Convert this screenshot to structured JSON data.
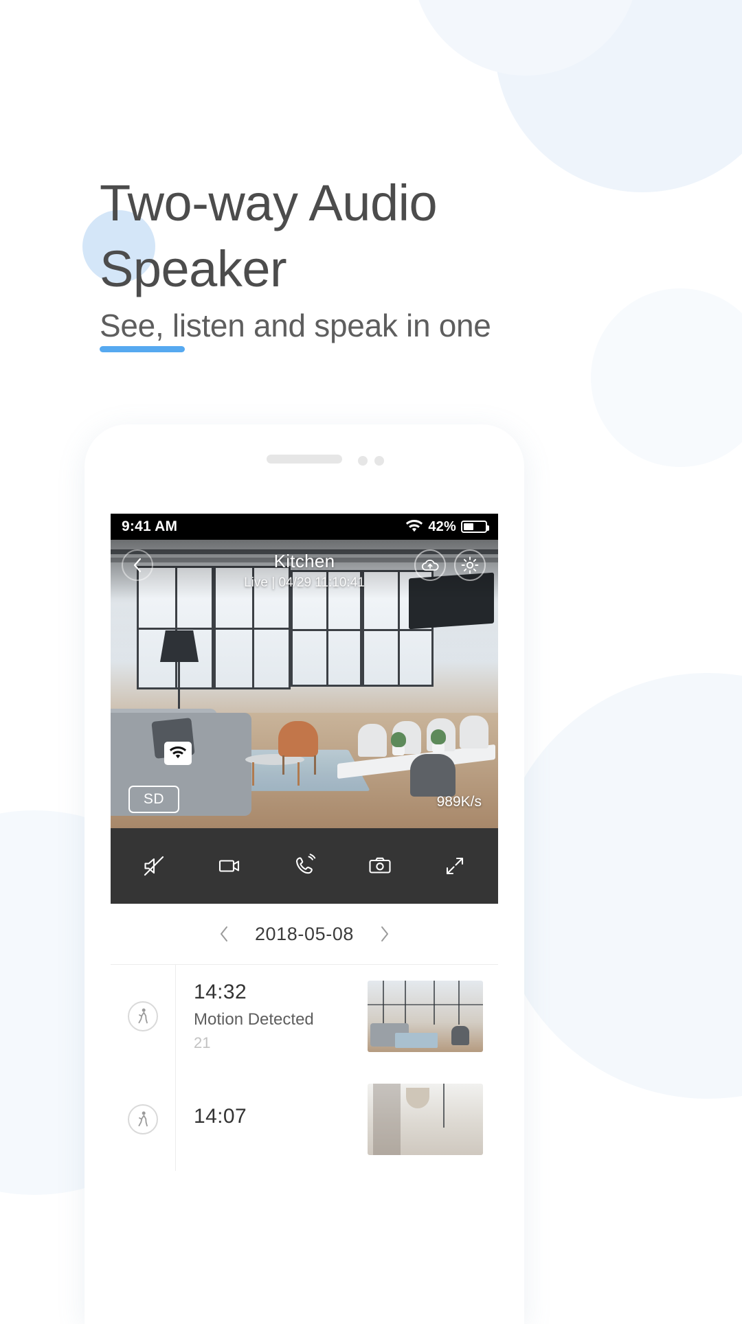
{
  "hero": {
    "headline": "Two-way Audio\nSpeaker",
    "subtitle": "See, listen and speak in one",
    "accent_color": "#56a9f0",
    "headline_color": "#4c4c4c"
  },
  "phone": {
    "status_bar": {
      "time": "9:41 AM",
      "wifi_icon": "wifi-icon",
      "battery_percent": "42%",
      "battery_level": 42
    },
    "video": {
      "back_icon": "chevron-left-icon",
      "camera_name": "Kitchen",
      "stream_status": "Live  |  04/29 11:10:41",
      "cloud_icon": "cloud-upload-icon",
      "settings_icon": "gear-icon",
      "connection_icon": "wifi-icon",
      "quality_badge": "SD",
      "bitrate": "989K/s"
    },
    "toolbar": [
      {
        "name": "mute-button",
        "icon": "speaker-mute-icon"
      },
      {
        "name": "record-button",
        "icon": "video-camera-icon"
      },
      {
        "name": "talk-button",
        "icon": "phone-talk-icon"
      },
      {
        "name": "snapshot-button",
        "icon": "camera-icon"
      },
      {
        "name": "fullscreen-button",
        "icon": "expand-icon"
      }
    ],
    "date_nav": {
      "prev_icon": "chevron-left-icon",
      "date": "2018-05-08",
      "next_icon": "chevron-right-icon"
    },
    "events": [
      {
        "time": "14:32",
        "description": "Motion Detected",
        "meta": "21",
        "icon": "walking-person-icon"
      },
      {
        "time": "14:07",
        "description": "",
        "meta": "",
        "icon": "walking-person-icon"
      }
    ]
  }
}
